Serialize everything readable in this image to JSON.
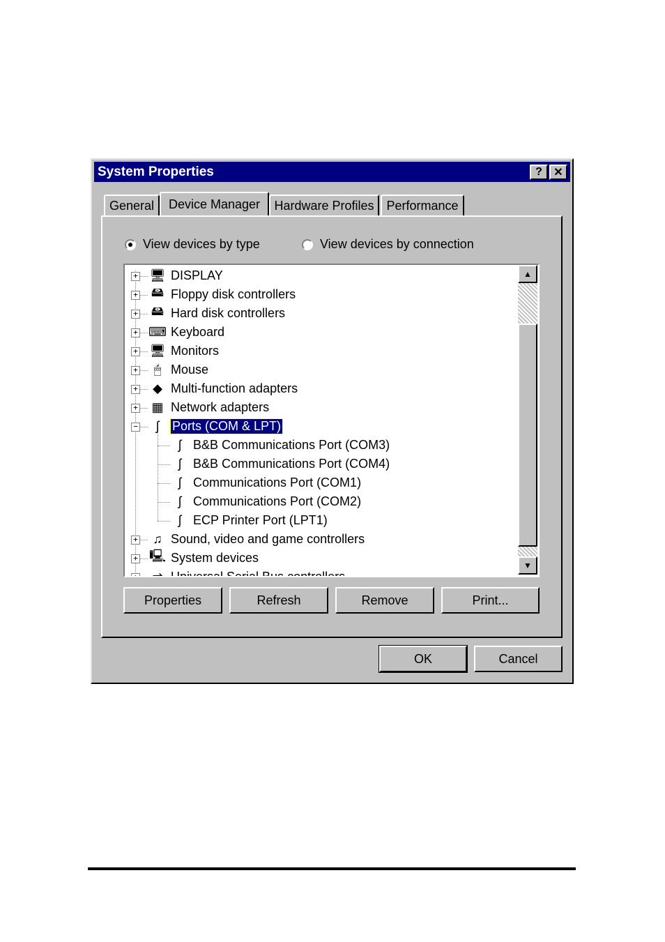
{
  "window": {
    "title": "System Properties",
    "help_btn": "?",
    "close_btn": "✕"
  },
  "tabs": [
    {
      "label": "General"
    },
    {
      "label": "Device Manager",
      "active": true
    },
    {
      "label": "Hardware Profiles"
    },
    {
      "label": "Performance"
    }
  ],
  "view_options": {
    "by_type": "View devices by type",
    "by_connection": "View devices by connection",
    "selected": "by_type"
  },
  "tree": {
    "items": [
      {
        "label": "DISPLAY",
        "icon": "monitor-icon",
        "glyph": "🖥",
        "expander": "+"
      },
      {
        "label": "Floppy disk controllers",
        "icon": "disk-controller-icon",
        "glyph": "🖴",
        "expander": "+"
      },
      {
        "label": "Hard disk controllers",
        "icon": "disk-controller-icon",
        "glyph": "🖴",
        "expander": "+"
      },
      {
        "label": "Keyboard",
        "icon": "keyboard-icon",
        "glyph": "⌨",
        "expander": "+"
      },
      {
        "label": "Monitors",
        "icon": "monitor-icon",
        "glyph": "🖥",
        "expander": "+"
      },
      {
        "label": "Mouse",
        "icon": "mouse-icon",
        "glyph": "🖱",
        "expander": "+"
      },
      {
        "label": "Multi-function adapters",
        "icon": "adapter-icon",
        "glyph": "◆",
        "expander": "+"
      },
      {
        "label": "Network adapters",
        "icon": "network-card-icon",
        "glyph": "▦",
        "expander": "+"
      },
      {
        "label": "Ports (COM & LPT)",
        "icon": "port-connector-icon",
        "glyph": "ʃ",
        "expander": "−",
        "selected": true
      },
      {
        "label": "B&B Communications Port (COM3)",
        "icon": "port-connector-icon",
        "glyph": "ʃ",
        "child": true
      },
      {
        "label": "B&B Communications Port (COM4)",
        "icon": "port-connector-icon",
        "glyph": "ʃ",
        "child": true
      },
      {
        "label": "Communications Port (COM1)",
        "icon": "port-connector-icon",
        "glyph": "ʃ",
        "child": true
      },
      {
        "label": "Communications Port (COM2)",
        "icon": "port-connector-icon",
        "glyph": "ʃ",
        "child": true
      },
      {
        "label": "ECP Printer Port (LPT1)",
        "icon": "port-connector-icon",
        "glyph": "ʃ",
        "child": true
      },
      {
        "label": "Sound, video and game controllers",
        "icon": "speaker-icon",
        "glyph": "♫",
        "expander": "+"
      },
      {
        "label": "System devices",
        "icon": "computer-icon",
        "glyph": "🖳",
        "expander": "+"
      },
      {
        "label": "Universal Serial Bus controllers",
        "icon": "usb-icon",
        "glyph": "⇌",
        "expander": "+"
      }
    ]
  },
  "scrollbar": {
    "up": "▲",
    "down": "▼"
  },
  "actions": {
    "properties": "Properties",
    "refresh": "Refresh",
    "remove": "Remove",
    "print": "Print..."
  },
  "footer": {
    "ok": "OK",
    "cancel": "Cancel"
  }
}
